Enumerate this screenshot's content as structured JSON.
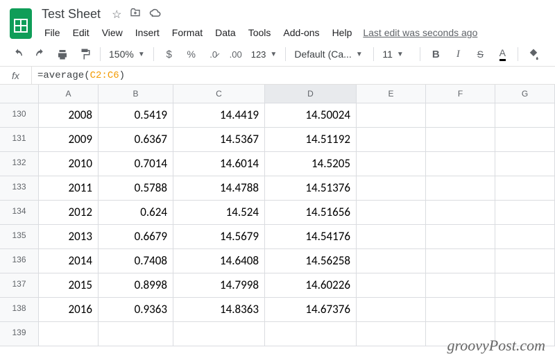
{
  "doc": {
    "title": "Test Sheet",
    "last_edit": "Last edit was seconds ago"
  },
  "menubar": [
    "File",
    "Edit",
    "View",
    "Insert",
    "Format",
    "Data",
    "Tools",
    "Add-ons",
    "Help"
  ],
  "toolbar": {
    "zoom": "150%",
    "font": "Default (Ca...",
    "font_size": "11"
  },
  "formula": {
    "prefix": "=average(",
    "ref": "C2:C6",
    "suffix": ")"
  },
  "columns": [
    "A",
    "B",
    "C",
    "D",
    "E",
    "F",
    "G"
  ],
  "selected_column_index": 3,
  "rows": [
    {
      "n": "130",
      "cells": [
        "2008",
        "0.5419",
        "14.4419",
        "14.50024",
        "",
        "",
        ""
      ]
    },
    {
      "n": "131",
      "cells": [
        "2009",
        "0.6367",
        "14.5367",
        "14.51192",
        "",
        "",
        ""
      ]
    },
    {
      "n": "132",
      "cells": [
        "2010",
        "0.7014",
        "14.6014",
        "14.5205",
        "",
        "",
        ""
      ]
    },
    {
      "n": "133",
      "cells": [
        "2011",
        "0.5788",
        "14.4788",
        "14.51376",
        "",
        "",
        ""
      ]
    },
    {
      "n": "134",
      "cells": [
        "2012",
        "0.624",
        "14.524",
        "14.51656",
        "",
        "",
        ""
      ]
    },
    {
      "n": "135",
      "cells": [
        "2013",
        "0.6679",
        "14.5679",
        "14.54176",
        "",
        "",
        ""
      ]
    },
    {
      "n": "136",
      "cells": [
        "2014",
        "0.7408",
        "14.6408",
        "14.56258",
        "",
        "",
        ""
      ]
    },
    {
      "n": "137",
      "cells": [
        "2015",
        "0.8998",
        "14.7998",
        "14.60226",
        "",
        "",
        ""
      ]
    },
    {
      "n": "138",
      "cells": [
        "2016",
        "0.9363",
        "14.8363",
        "14.67376",
        "",
        "",
        ""
      ]
    },
    {
      "n": "139",
      "cells": [
        "",
        "",
        "",
        "",
        "",
        "",
        ""
      ]
    }
  ],
  "watermark": "groovyPost.com"
}
